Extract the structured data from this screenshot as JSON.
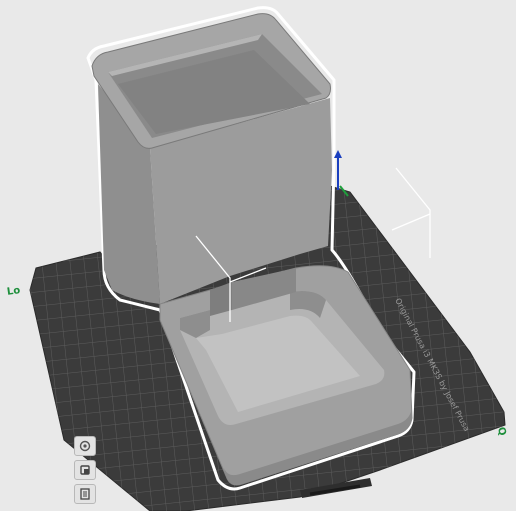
{
  "viewport": {
    "bed_label_left": "Lo",
    "bed_label_right": "Q",
    "bed_brand_text": "Original Prusa i3 MK3S by Josef Prusa"
  },
  "toolbar": {
    "items": [
      {
        "icon": "settings-gear-icon"
      },
      {
        "icon": "paint-bucket-icon"
      },
      {
        "icon": "layers-icon"
      }
    ]
  },
  "colors": {
    "background": "#e9e9e9",
    "bed": "#3c3c3c",
    "bed_grid": "#5a5a5a",
    "model": "#9a9a9a",
    "selection_outline": "#ffffff",
    "label_green": "#1e8f3c"
  }
}
